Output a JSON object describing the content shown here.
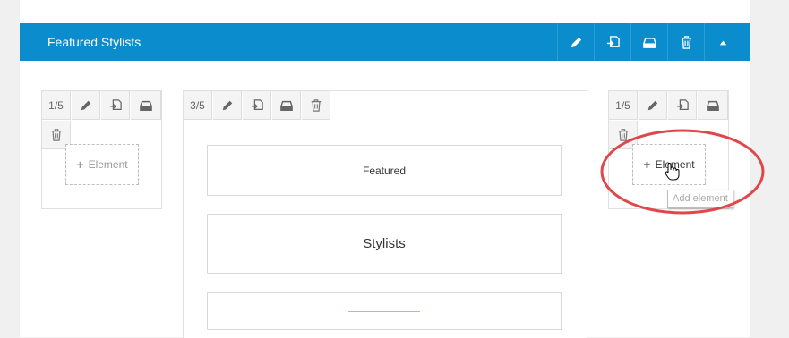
{
  "section": {
    "title": "Featured Stylists",
    "header_actions": [
      {
        "name": "edit-section-button",
        "icon": "pencil-icon"
      },
      {
        "name": "clone-section-button",
        "icon": "clone-icon"
      },
      {
        "name": "save-section-button",
        "icon": "save-icon"
      },
      {
        "name": "delete-section-button",
        "icon": "trash-icon"
      },
      {
        "name": "collapse-section-button",
        "icon": "caret-up-icon"
      }
    ]
  },
  "columns": [
    {
      "size": "1/5",
      "add_label": "Element"
    },
    {
      "size": "3/5",
      "blocks": [
        {
          "text": "Featured",
          "type": "text"
        },
        {
          "text": "Stylists",
          "type": "text"
        },
        {
          "text": "",
          "type": "divider"
        }
      ]
    },
    {
      "size": "1/5",
      "add_label": "Element",
      "tooltip": "Add element"
    }
  ],
  "colors": {
    "header_bg": "#0a8ccd",
    "highlight_ring": "#e0474c",
    "divider_line": "#c9b88f"
  }
}
